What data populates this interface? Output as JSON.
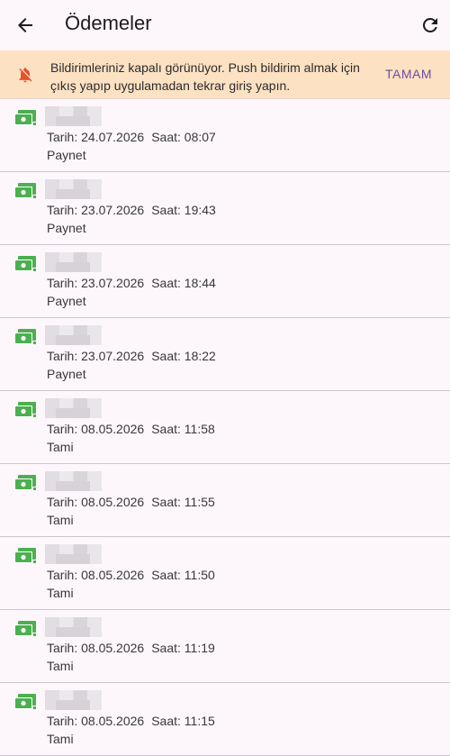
{
  "appbar": {
    "title": "Ödemeler"
  },
  "banner": {
    "message": "Bildirimleriniz kapalı görünüyor. Push bildirim almak için çıkış yapıp uygulamadan tekrar giriş yapın.",
    "action": "TAMAM"
  },
  "colors": {
    "accent": "#6a4ea0",
    "cash_icon": "#4caf50",
    "banner_bg": "#fde1c3",
    "bell": "#e5532d"
  },
  "payments": [
    {
      "date_label": "Tarih: 24.07.2026",
      "time_label": "Saat: 08:07",
      "provider": "Paynet"
    },
    {
      "date_label": "Tarih: 23.07.2026",
      "time_label": "Saat: 19:43",
      "provider": "Paynet"
    },
    {
      "date_label": "Tarih: 23.07.2026",
      "time_label": "Saat: 18:44",
      "provider": "Paynet"
    },
    {
      "date_label": "Tarih: 23.07.2026",
      "time_label": "Saat: 18:22",
      "provider": "Paynet"
    },
    {
      "date_label": "Tarih: 08.05.2026",
      "time_label": "Saat: 11:58",
      "provider": "Tami"
    },
    {
      "date_label": "Tarih: 08.05.2026",
      "time_label": "Saat: 11:55",
      "provider": "Tami"
    },
    {
      "date_label": "Tarih: 08.05.2026",
      "time_label": "Saat: 11:50",
      "provider": "Tami"
    },
    {
      "date_label": "Tarih: 08.05.2026",
      "time_label": "Saat: 11:19",
      "provider": "Tami"
    },
    {
      "date_label": "Tarih: 08.05.2026",
      "time_label": "Saat: 11:15",
      "provider": "Tami"
    }
  ]
}
